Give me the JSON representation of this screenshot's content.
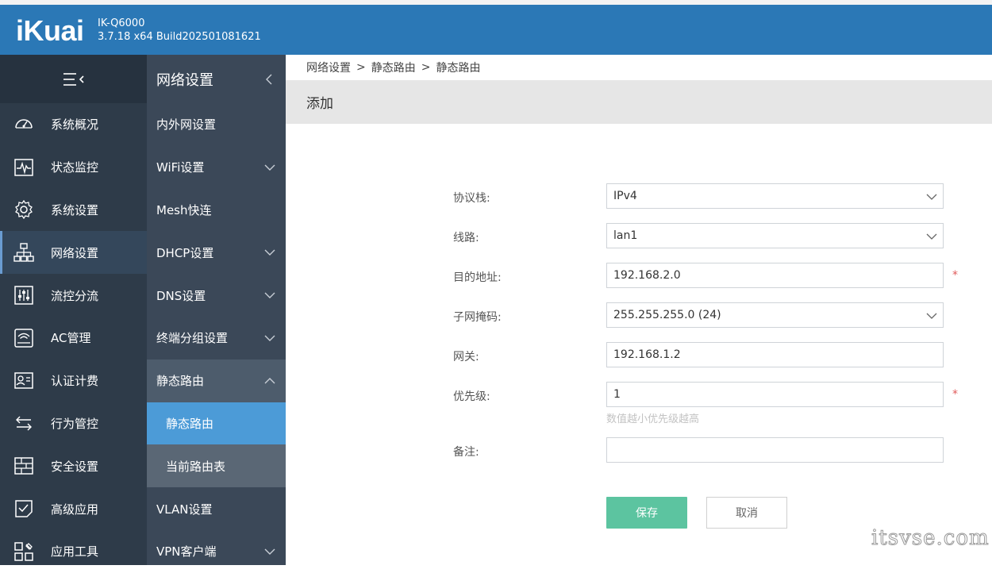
{
  "header": {
    "logo_text": "iKuai",
    "model": "IK-Q6000",
    "build": "3.7.18 x64 Build202501081621",
    "bg_color": "#2b78b6"
  },
  "sidebar": {
    "toggle_icon": "menu-collapse-icon",
    "items": [
      {
        "label": "系统概况",
        "icon": "dashboard-gauge-icon"
      },
      {
        "label": "状态监控",
        "icon": "monitor-pulse-icon"
      },
      {
        "label": "系统设置",
        "icon": "gear-icon"
      },
      {
        "label": "网络设置",
        "icon": "network-topology-icon",
        "active": true
      },
      {
        "label": "流控分流",
        "icon": "sliders-icon"
      },
      {
        "label": "AC管理",
        "icon": "wifi-router-icon"
      },
      {
        "label": "认证计费",
        "icon": "id-card-icon"
      },
      {
        "label": "行为管控",
        "icon": "transfer-arrows-icon"
      },
      {
        "label": "安全设置",
        "icon": "firewall-icon"
      },
      {
        "label": "高级应用",
        "icon": "checklist-icon"
      },
      {
        "label": "应用工具",
        "icon": "tools-grid-icon"
      }
    ]
  },
  "subnav": {
    "title": "网络设置",
    "items": [
      {
        "label": "内外网设置"
      },
      {
        "label": "WiFi设置"
      },
      {
        "label": "Mesh快连"
      },
      {
        "label": "DHCP设置"
      },
      {
        "label": "DNS设置"
      },
      {
        "label": "终端分组设置"
      },
      {
        "label": "静态路由"
      },
      {
        "label": "静态路由"
      },
      {
        "label": "当前路由表"
      },
      {
        "label": "VLAN设置"
      },
      {
        "label": "VPN客户端"
      }
    ]
  },
  "breadcrumb": {
    "items": [
      "网络设置",
      "静态路由",
      "静态路由"
    ],
    "separator": ">"
  },
  "panel": {
    "title": "添加"
  },
  "form": {
    "protocol": {
      "label": "协议栈:",
      "value": "IPv4"
    },
    "line": {
      "label": "线路:",
      "value": "lan1"
    },
    "dest": {
      "label": "目的地址:",
      "value": "192.168.2.0",
      "required": "*"
    },
    "mask": {
      "label": "子网掩码:",
      "value": "255.255.255.0 (24)"
    },
    "gateway": {
      "label": "网关:",
      "value": "192.168.1.2"
    },
    "priority": {
      "label": "优先级:",
      "value": "1",
      "required": "*",
      "hint": "数值越小优先级越高"
    },
    "remark": {
      "label": "备注:",
      "value": ""
    }
  },
  "buttons": {
    "save": "保存",
    "cancel": "取消",
    "save_color": "#5cc4a0"
  },
  "watermark": "itsvse.com"
}
